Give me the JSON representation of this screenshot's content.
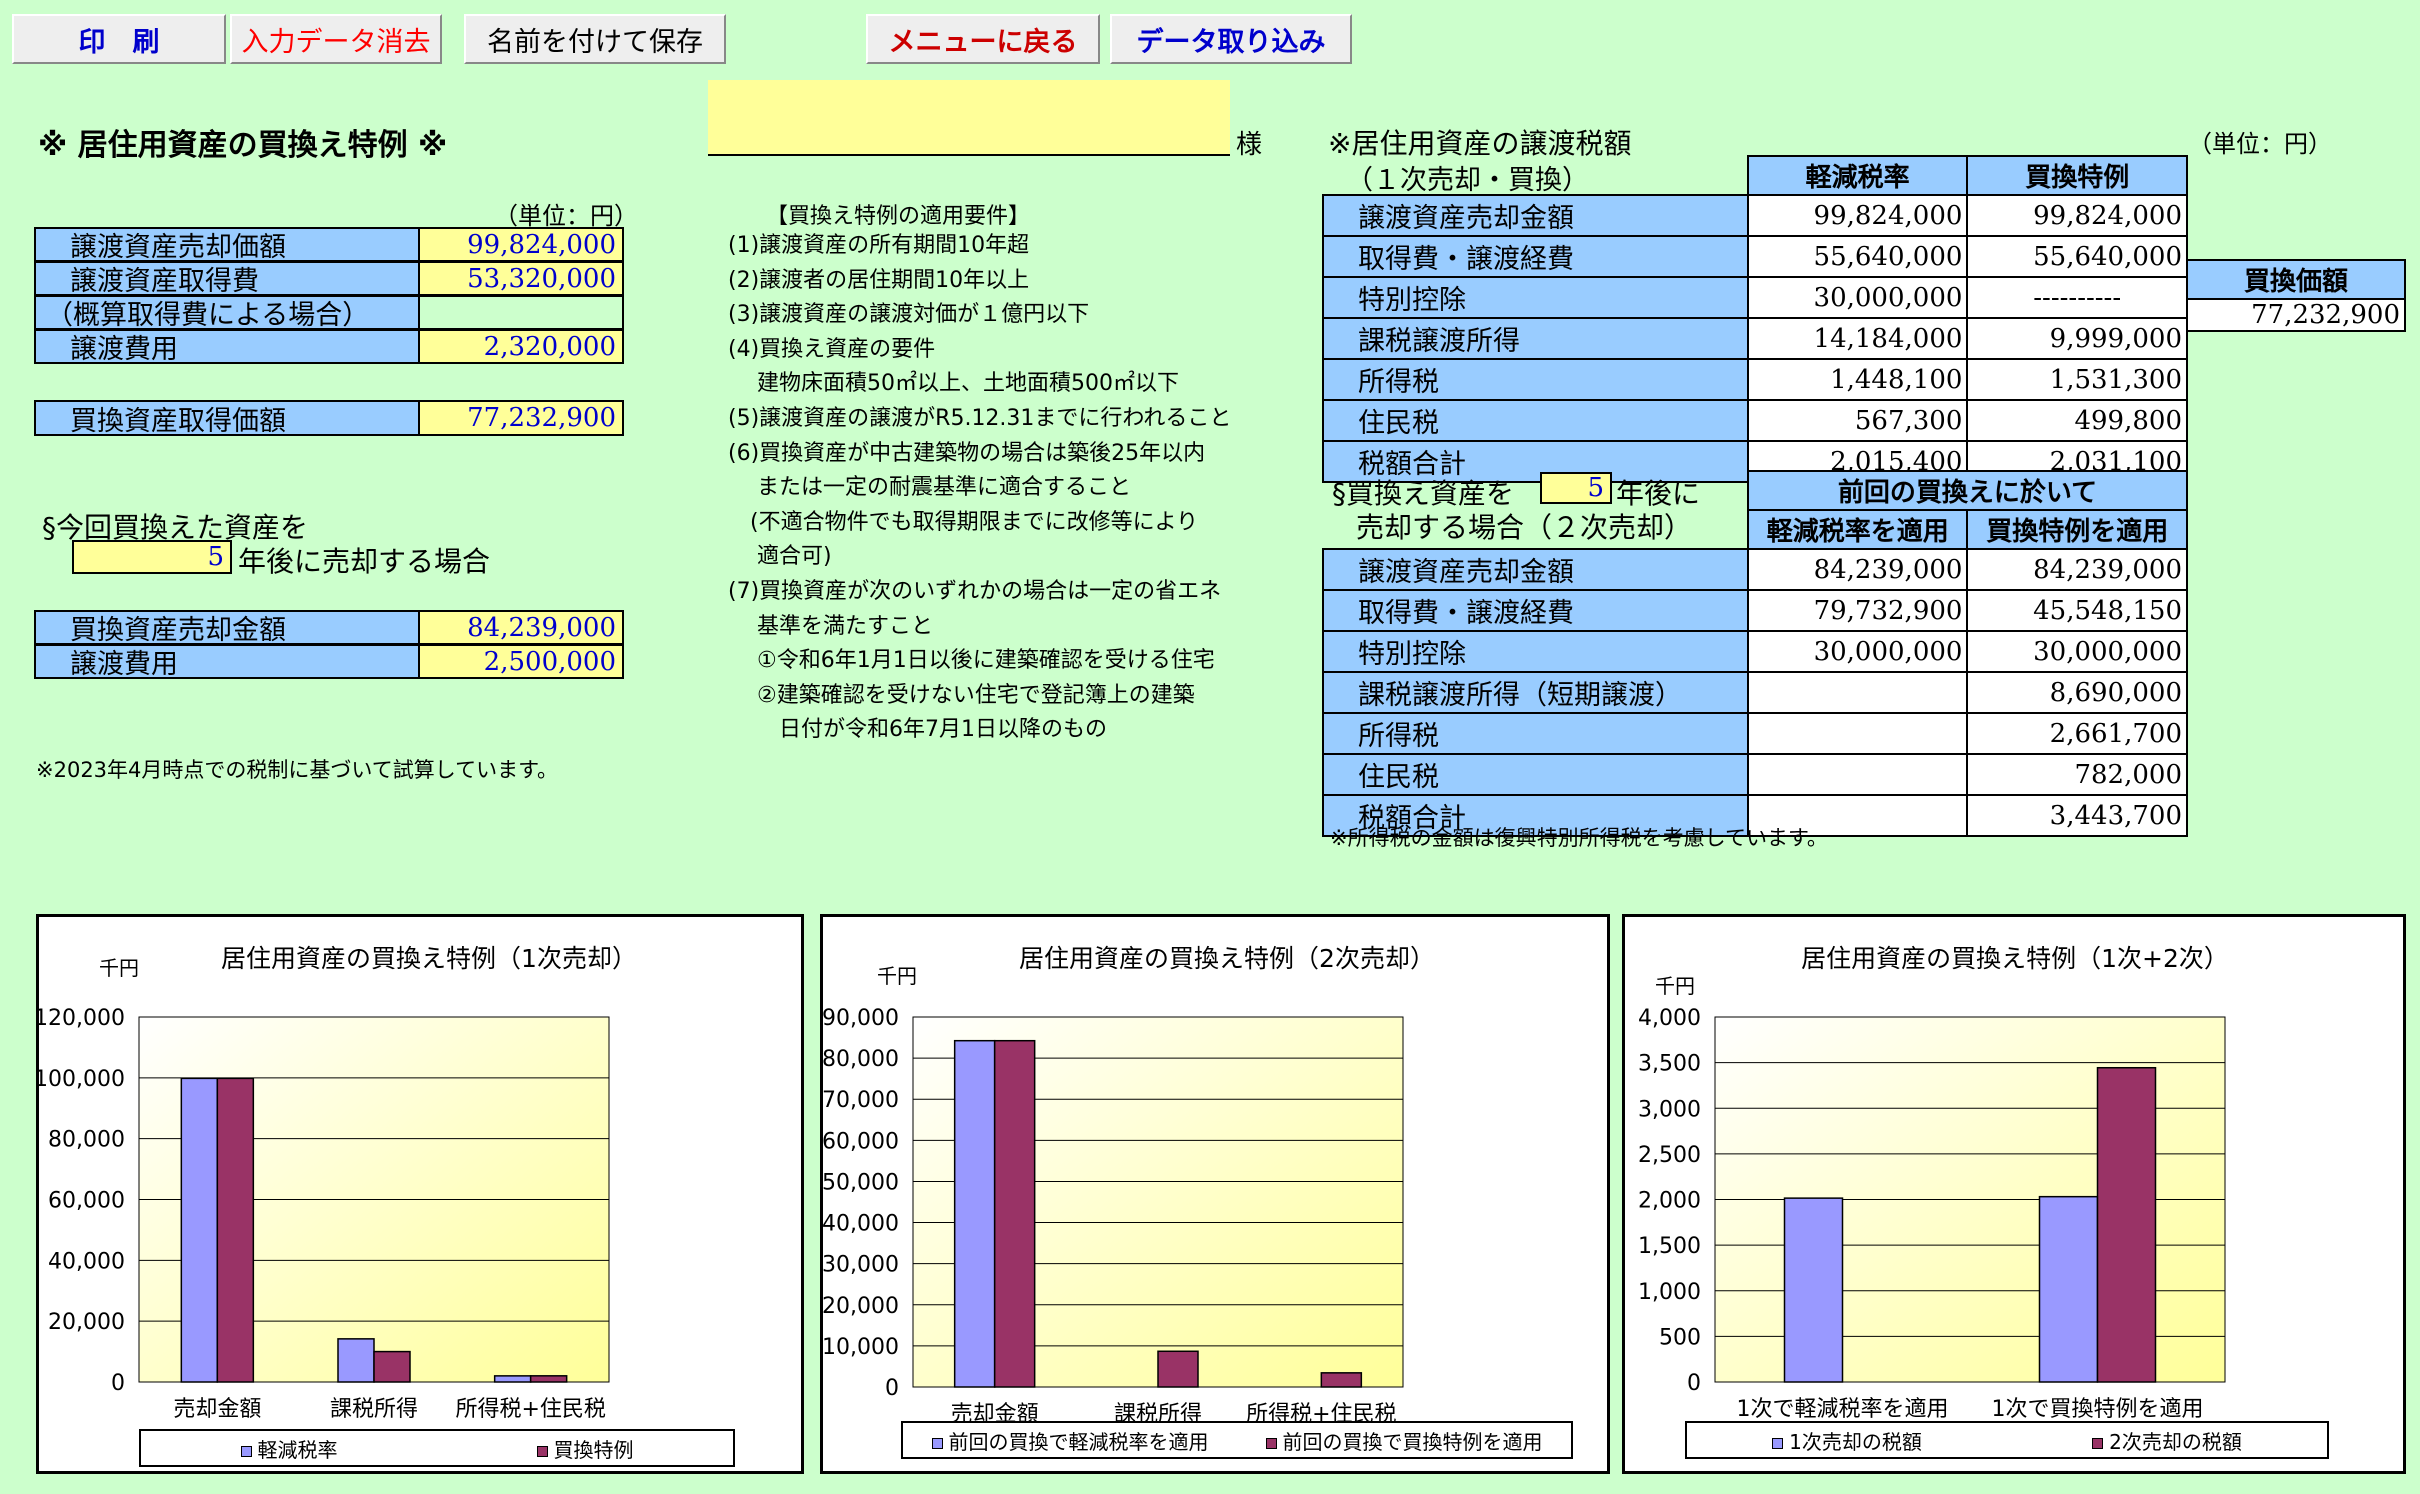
{
  "toolbar": {
    "print": "印　刷",
    "clear": "入力データ消去",
    "save_as": "名前を付けて保存",
    "menu": "メニューに戻る",
    "import": "データ取り込み"
  },
  "colors": {
    "background": "#ccffcc",
    "header_cell": "#99ccff",
    "input_cell": "#ffff99",
    "series1": "#9999ff",
    "series2": "#993366"
  },
  "title": "※ 居住用資産の買換え特例 ※",
  "customer": {
    "name": "",
    "suffix": "様"
  },
  "left": {
    "unit": "（単位：円）",
    "rows": [
      {
        "label": "譲渡資産売却価額",
        "value": "99,824,000"
      },
      {
        "label": "譲渡資産取得費",
        "value": "53,320,000"
      },
      {
        "label": "（概算取得費による場合）",
        "value": ""
      },
      {
        "label": "譲渡費用",
        "value": "2,320,000"
      }
    ],
    "replacement": {
      "label": "買換資産取得価額",
      "value": "77,232,900"
    },
    "resale_line1": "§今回買換えた資産を",
    "resale_years": "5",
    "resale_line2": "年後に売却する場合",
    "resale_rows": [
      {
        "label": "買換資産売却金額",
        "value": "84,239,000"
      },
      {
        "label": "譲渡費用",
        "value": "2,500,000"
      }
    ],
    "footnote": "※2023年4月時点での税制に基づいて試算しています。"
  },
  "requirements": {
    "title": "【買換え特例の適用要件】",
    "lines": [
      "(1)譲渡資産の所有期間10年超",
      "(2)譲渡者の居住期間10年以上",
      "(3)譲渡資産の譲渡対価が１億円以下",
      "(4)買換え資産の要件",
      "　 建物床面積50㎡以上、土地面積500㎡以下",
      "(5)譲渡資産の譲渡がR5.12.31までに行われること",
      "(6)買換資産が中古建築物の場合は築後25年以内",
      "　 または一定の耐震基準に適合すること",
      "　(不適合物件でも取得期限までに改修等により",
      "　 適合可)",
      "(7)買換資産が次のいずれかの場合は一定の省エネ",
      "　 基準を満たすこと",
      "　 ①令和6年1月1日以後に建築確認を受ける住宅",
      "　 ②建築確認を受けない住宅で登記簿上の建築",
      "　　 日付が令和6年7月1日以降のもの"
    ]
  },
  "table1": {
    "title": "※居住用資産の譲渡税額",
    "subtitle": "（１次売却・買換）",
    "unit": "（単位：円）",
    "col1": "軽減税率",
    "col2": "買換特例",
    "rows": [
      {
        "label": "譲渡資産売却金額",
        "a": "99,824,000",
        "b": "99,824,000"
      },
      {
        "label": "取得費・譲渡経費",
        "a": "55,640,000",
        "b": "55,640,000"
      },
      {
        "label": "特別控除",
        "a": "30,000,000",
        "b": "----------"
      },
      {
        "label": "課税譲渡所得",
        "a": "14,184,000",
        "b": "9,999,000"
      },
      {
        "label": "所得税",
        "a": "1,448,100",
        "b": "1,531,300"
      },
      {
        "label": "住民税",
        "a": "567,300",
        "b": "499,800"
      },
      {
        "label": "税額合計",
        "a": "2,015,400",
        "b": "2,031,100"
      }
    ],
    "side_header": "買換価額",
    "side_value": "77,232,900"
  },
  "table2": {
    "line1a": "§買換え資産を",
    "years": "5",
    "line1b": "年後に",
    "line2": "売却する場合（２次売却）",
    "group_header": "前回の買換えに於いて",
    "col1": "軽減税率を適用",
    "col2": "買換特例を適用",
    "rows": [
      {
        "label": "譲渡資産売却金額",
        "a": "84,239,000",
        "b": "84,239,000"
      },
      {
        "label": "取得費・譲渡経費",
        "a": "79,732,900",
        "b": "45,548,150"
      },
      {
        "label": "特別控除",
        "a": "30,000,000",
        "b": "30,000,000"
      },
      {
        "label": "課税譲渡所得（短期譲渡）",
        "a": "",
        "b": "8,690,000"
      },
      {
        "label": "所得税",
        "a": "",
        "b": "2,661,700"
      },
      {
        "label": "住民税",
        "a": "",
        "b": "782,000"
      },
      {
        "label": "税額合計",
        "a": "",
        "b": "3,443,700"
      }
    ],
    "footnote": "※所得税の金額は復興特別所得税を考慮しています。"
  },
  "chart_data": [
    {
      "type": "bar",
      "title": "居住用資産の買換え特例（1次売却）",
      "ylabel": "千円",
      "categories": [
        "売却金額",
        "課税所得",
        "所得税+住民税"
      ],
      "series": [
        {
          "name": "軽減税率",
          "values": [
            99824,
            14184,
            2015
          ]
        },
        {
          "name": "買換特例",
          "values": [
            99824,
            9999,
            2031
          ]
        }
      ],
      "ylim": [
        0,
        120000
      ],
      "yticks": [
        "0",
        "20,000",
        "40,000",
        "60,000",
        "80,000",
        "100,000",
        "120,000"
      ],
      "grid": true,
      "legend": "bottom"
    },
    {
      "type": "bar",
      "title": "居住用資産の買換え特例（2次売却）",
      "ylabel": "千円",
      "categories": [
        "売却金額",
        "課税所得",
        "所得税+住民税"
      ],
      "series": [
        {
          "name": "前回の買換で軽減税率を適用",
          "values": [
            84239,
            0,
            0
          ]
        },
        {
          "name": "前回の買換で買換特例を適用",
          "values": [
            84239,
            8690,
            3444
          ]
        }
      ],
      "ylim": [
        0,
        90000
      ],
      "yticks": [
        "0",
        "10,000",
        "20,000",
        "30,000",
        "40,000",
        "50,000",
        "60,000",
        "70,000",
        "80,000",
        "90,000"
      ],
      "grid": true,
      "legend": "bottom"
    },
    {
      "type": "bar",
      "title": "居住用資産の買換え特例（1次+2次）",
      "ylabel": "千円",
      "categories": [
        "1次で軽減税率を適用",
        "1次で買換特例を適用"
      ],
      "series": [
        {
          "name": "1次売却の税額",
          "values": [
            2015,
            2031
          ]
        },
        {
          "name": "2次売却の税額",
          "values": [
            0,
            3444
          ]
        }
      ],
      "ylim": [
        0,
        4000
      ],
      "yticks": [
        "0",
        "500",
        "1,000",
        "1,500",
        "2,000",
        "2,500",
        "3,000",
        "3,500",
        "4,000"
      ],
      "grid": true,
      "legend": "bottom"
    }
  ]
}
